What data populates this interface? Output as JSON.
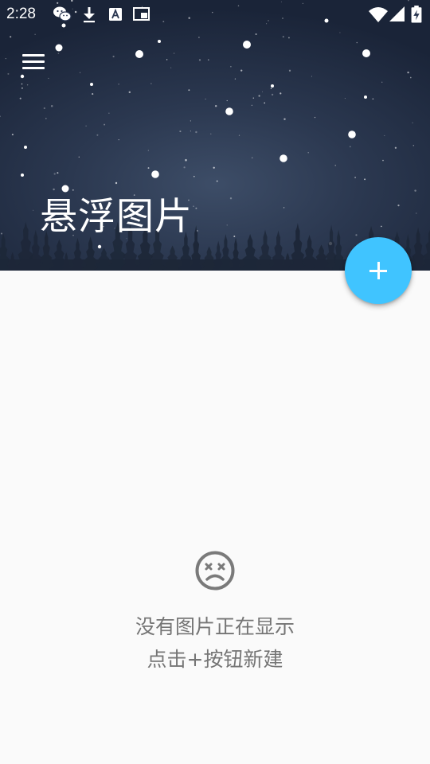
{
  "status_bar": {
    "time": "2:28",
    "left_icons": [
      "wechat-icon",
      "download-icon",
      "keyboard-a-icon",
      "picture-in-picture-icon"
    ],
    "right_icons": [
      "wifi-icon",
      "cellular-signal-icon",
      "battery-charging-icon"
    ]
  },
  "header": {
    "title": "悬浮图片",
    "menu_icon": "hamburger-menu-icon",
    "background": "night-sky-snow-forest"
  },
  "fab": {
    "icon": "plus-icon",
    "color": "#40c4ff"
  },
  "empty_state": {
    "icon": "sad-face-icon",
    "line1": "没有图片正在显示",
    "line2": "点击+按钮新建"
  },
  "colors": {
    "page_background": "#fafafa",
    "header_background": "#2b3850",
    "empty_text": "#757575"
  }
}
